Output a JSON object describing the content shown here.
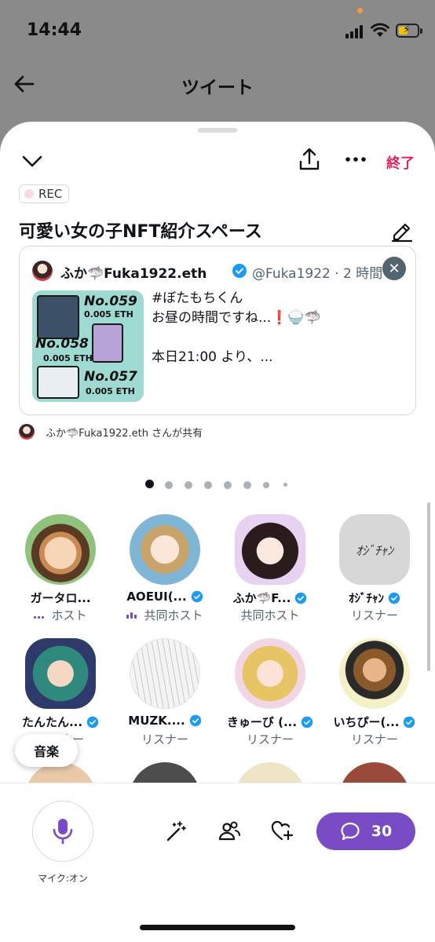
{
  "status_bar": {
    "time": "14:44"
  },
  "top_nav": {
    "title": "ツイート"
  },
  "sheet": {
    "end_label": "終了",
    "rec_label": "REC",
    "space_title": "可愛い女の子NFT紹介スペース"
  },
  "pinned_tweet": {
    "author_name": "ふか🦈Fuka1922.eth",
    "handle_time": "@Fuka1922 · 2 時間",
    "media_texts": [
      "No.059",
      "0.005 ETH",
      "No.058",
      "0.005 ETH",
      "No.057",
      "0.005 ETH"
    ],
    "lines": [
      "#ぼたもちくん",
      "お昼の時間ですね...❗️🍚🦈",
      "",
      "本日21:00 より、..."
    ]
  },
  "shared_by": "ふか🦈Fuka1922.eth さんが共有",
  "pager": {
    "count": 8,
    "active": 0
  },
  "participants": [
    {
      "name": "ガータロ...",
      "role": "ホスト",
      "speaking": true,
      "verified": false
    },
    {
      "name": "AOEUI(...",
      "role": "共同ホスト",
      "speaking": true,
      "verified": true
    },
    {
      "name": "ふか🦈F...",
      "role": "共同ホスト",
      "speaking": false,
      "verified": true
    },
    {
      "name": "ｵｼﾞﾁｬﾝ",
      "role": "リスナー",
      "speaking": false,
      "verified": true
    },
    {
      "name": "たんたん...",
      "role": "リスナー",
      "speaking": false,
      "verified": true
    },
    {
      "name": "MUZK....",
      "role": "リスナー",
      "speaking": false,
      "verified": true
    },
    {
      "name": "きゅーび (...",
      "role": "リスナー",
      "speaking": false,
      "verified": true
    },
    {
      "name": "いちぴー(...",
      "role": "リスナー",
      "speaking": false,
      "verified": true
    }
  ],
  "music_pill": "音楽",
  "bottom_bar": {
    "mic_label": "マイク:オン",
    "chat_count": "30",
    "icons": [
      "sparkle-wand-icon",
      "people-icon",
      "heart-plus-icon",
      "chat-bubble-icon",
      "microphone-icon"
    ]
  },
  "colors": {
    "accent": "#794bc4",
    "end": "#e0245e",
    "verified": "#1d9bf0",
    "muted": "#536471"
  }
}
